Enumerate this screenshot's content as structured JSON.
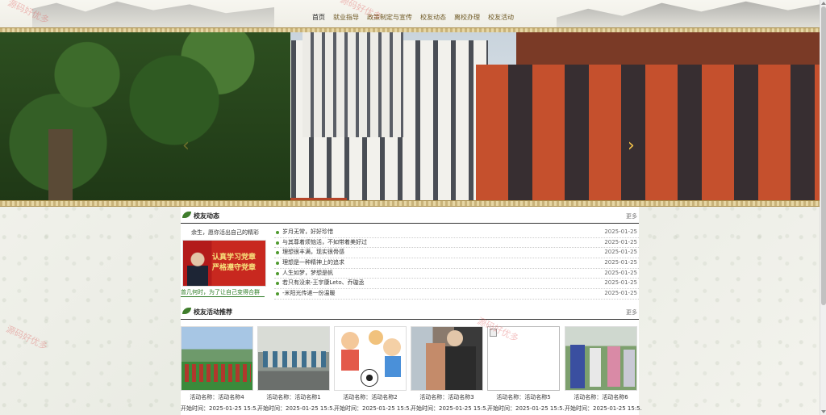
{
  "nav": {
    "items": [
      {
        "label": "首页",
        "active": true
      },
      {
        "label": "就业指导",
        "active": false
      },
      {
        "label": "政策制定与宣传",
        "active": false
      },
      {
        "label": "校友动态",
        "active": false
      },
      {
        "label": "离校办理",
        "active": false
      },
      {
        "label": "校友活动",
        "active": false
      }
    ]
  },
  "watermark": "源码好优多",
  "banner": {
    "prev_icon": "chevron-left-icon",
    "next_icon": "chevron-right-icon"
  },
  "alumni_news": {
    "title": "校友动态",
    "more": "更多",
    "feature": {
      "caption": "余生，愿你活出自己的精彩",
      "image_text_1": "认真学习党章",
      "image_text_2": "严格遵守党章",
      "link_text": "曾几何时，为了让自己变得合群"
    },
    "items": [
      {
        "text": "岁月无常，好好珍惜",
        "date": "2025-01-25"
      },
      {
        "text": "与其尊着烦恼活，不如带着美好过",
        "date": "2025-01-25"
      },
      {
        "text": "理想很丰满，现实很骨感",
        "date": "2025-01-25"
      },
      {
        "text": "理想是一种精神上的追求",
        "date": "2025-01-25"
      },
      {
        "text": "人生如梦，梦想是帆",
        "date": "2025-01-25"
      },
      {
        "text": "若只有没来-王宇康Leto、乔璇丞",
        "date": "2025-01-25"
      },
      {
        "text": "-米阳光传递一份温暖",
        "date": "2025-01-25"
      }
    ]
  },
  "activities": {
    "title": "校友活动推荐",
    "more": "更多",
    "cards": [
      {
        "name": "活动名称：活动名称4",
        "time": "开始时间：2025-01-25 15:5..."
      },
      {
        "name": "活动名称：活动名称1",
        "time": "开始时间：2025-01-25 15:5..."
      },
      {
        "name": "活动名称：活动名称2",
        "time": "开始时间：2025-01-25 15:5..."
      },
      {
        "name": "活动名称：活动名称3",
        "time": "开始时间：2025-01-25 15:5..."
      },
      {
        "name": "活动名称：活动名称5",
        "time": "开始时间：2025-01-25 15:5..."
      },
      {
        "name": "活动名称：活动名称6",
        "time": "开始时间：2025-01-25 15:5..."
      }
    ]
  }
}
